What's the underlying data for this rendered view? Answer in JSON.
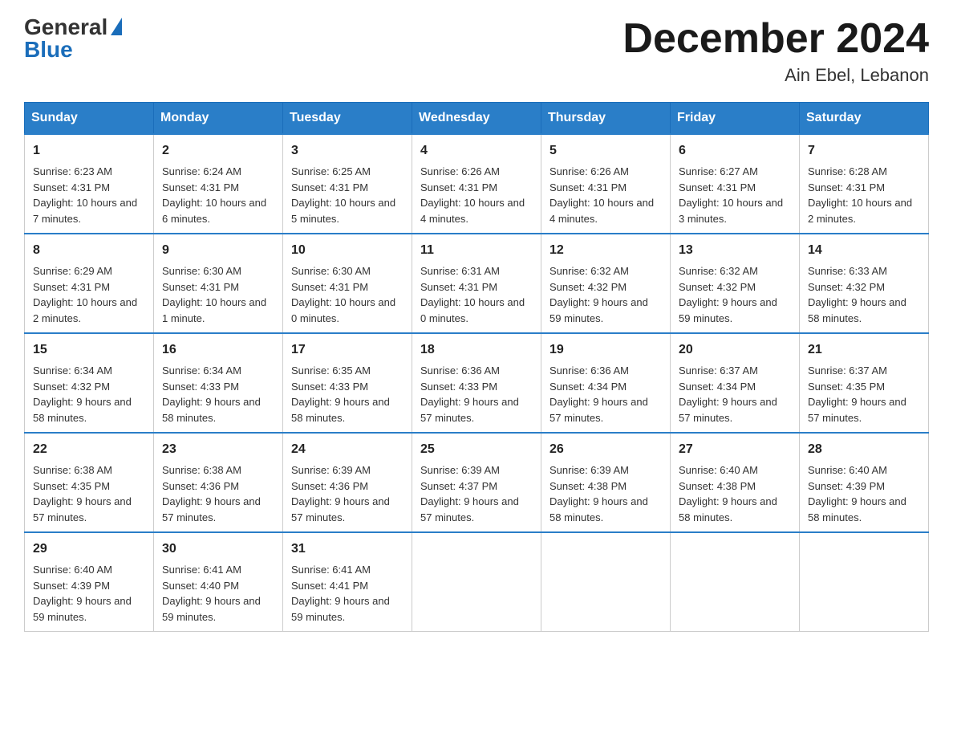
{
  "logo": {
    "general": "General",
    "blue": "Blue"
  },
  "header": {
    "title": "December 2024",
    "location": "Ain Ebel, Lebanon"
  },
  "weekdays": [
    "Sunday",
    "Monday",
    "Tuesday",
    "Wednesday",
    "Thursday",
    "Friday",
    "Saturday"
  ],
  "weeks": [
    [
      {
        "day": "1",
        "sunrise": "6:23 AM",
        "sunset": "4:31 PM",
        "daylight": "10 hours and 7 minutes."
      },
      {
        "day": "2",
        "sunrise": "6:24 AM",
        "sunset": "4:31 PM",
        "daylight": "10 hours and 6 minutes."
      },
      {
        "day": "3",
        "sunrise": "6:25 AM",
        "sunset": "4:31 PM",
        "daylight": "10 hours and 5 minutes."
      },
      {
        "day": "4",
        "sunrise": "6:26 AM",
        "sunset": "4:31 PM",
        "daylight": "10 hours and 4 minutes."
      },
      {
        "day": "5",
        "sunrise": "6:26 AM",
        "sunset": "4:31 PM",
        "daylight": "10 hours and 4 minutes."
      },
      {
        "day": "6",
        "sunrise": "6:27 AM",
        "sunset": "4:31 PM",
        "daylight": "10 hours and 3 minutes."
      },
      {
        "day": "7",
        "sunrise": "6:28 AM",
        "sunset": "4:31 PM",
        "daylight": "10 hours and 2 minutes."
      }
    ],
    [
      {
        "day": "8",
        "sunrise": "6:29 AM",
        "sunset": "4:31 PM",
        "daylight": "10 hours and 2 minutes."
      },
      {
        "day": "9",
        "sunrise": "6:30 AM",
        "sunset": "4:31 PM",
        "daylight": "10 hours and 1 minute."
      },
      {
        "day": "10",
        "sunrise": "6:30 AM",
        "sunset": "4:31 PM",
        "daylight": "10 hours and 0 minutes."
      },
      {
        "day": "11",
        "sunrise": "6:31 AM",
        "sunset": "4:31 PM",
        "daylight": "10 hours and 0 minutes."
      },
      {
        "day": "12",
        "sunrise": "6:32 AM",
        "sunset": "4:32 PM",
        "daylight": "9 hours and 59 minutes."
      },
      {
        "day": "13",
        "sunrise": "6:32 AM",
        "sunset": "4:32 PM",
        "daylight": "9 hours and 59 minutes."
      },
      {
        "day": "14",
        "sunrise": "6:33 AM",
        "sunset": "4:32 PM",
        "daylight": "9 hours and 58 minutes."
      }
    ],
    [
      {
        "day": "15",
        "sunrise": "6:34 AM",
        "sunset": "4:32 PM",
        "daylight": "9 hours and 58 minutes."
      },
      {
        "day": "16",
        "sunrise": "6:34 AM",
        "sunset": "4:33 PM",
        "daylight": "9 hours and 58 minutes."
      },
      {
        "day": "17",
        "sunrise": "6:35 AM",
        "sunset": "4:33 PM",
        "daylight": "9 hours and 58 minutes."
      },
      {
        "day": "18",
        "sunrise": "6:36 AM",
        "sunset": "4:33 PM",
        "daylight": "9 hours and 57 minutes."
      },
      {
        "day": "19",
        "sunrise": "6:36 AM",
        "sunset": "4:34 PM",
        "daylight": "9 hours and 57 minutes."
      },
      {
        "day": "20",
        "sunrise": "6:37 AM",
        "sunset": "4:34 PM",
        "daylight": "9 hours and 57 minutes."
      },
      {
        "day": "21",
        "sunrise": "6:37 AM",
        "sunset": "4:35 PM",
        "daylight": "9 hours and 57 minutes."
      }
    ],
    [
      {
        "day": "22",
        "sunrise": "6:38 AM",
        "sunset": "4:35 PM",
        "daylight": "9 hours and 57 minutes."
      },
      {
        "day": "23",
        "sunrise": "6:38 AM",
        "sunset": "4:36 PM",
        "daylight": "9 hours and 57 minutes."
      },
      {
        "day": "24",
        "sunrise": "6:39 AM",
        "sunset": "4:36 PM",
        "daylight": "9 hours and 57 minutes."
      },
      {
        "day": "25",
        "sunrise": "6:39 AM",
        "sunset": "4:37 PM",
        "daylight": "9 hours and 57 minutes."
      },
      {
        "day": "26",
        "sunrise": "6:39 AM",
        "sunset": "4:38 PM",
        "daylight": "9 hours and 58 minutes."
      },
      {
        "day": "27",
        "sunrise": "6:40 AM",
        "sunset": "4:38 PM",
        "daylight": "9 hours and 58 minutes."
      },
      {
        "day": "28",
        "sunrise": "6:40 AM",
        "sunset": "4:39 PM",
        "daylight": "9 hours and 58 minutes."
      }
    ],
    [
      {
        "day": "29",
        "sunrise": "6:40 AM",
        "sunset": "4:39 PM",
        "daylight": "9 hours and 59 minutes."
      },
      {
        "day": "30",
        "sunrise": "6:41 AM",
        "sunset": "4:40 PM",
        "daylight": "9 hours and 59 minutes."
      },
      {
        "day": "31",
        "sunrise": "6:41 AM",
        "sunset": "4:41 PM",
        "daylight": "9 hours and 59 minutes."
      },
      null,
      null,
      null,
      null
    ]
  ],
  "labels": {
    "sunrise": "Sunrise:",
    "sunset": "Sunset:",
    "daylight": "Daylight:"
  }
}
